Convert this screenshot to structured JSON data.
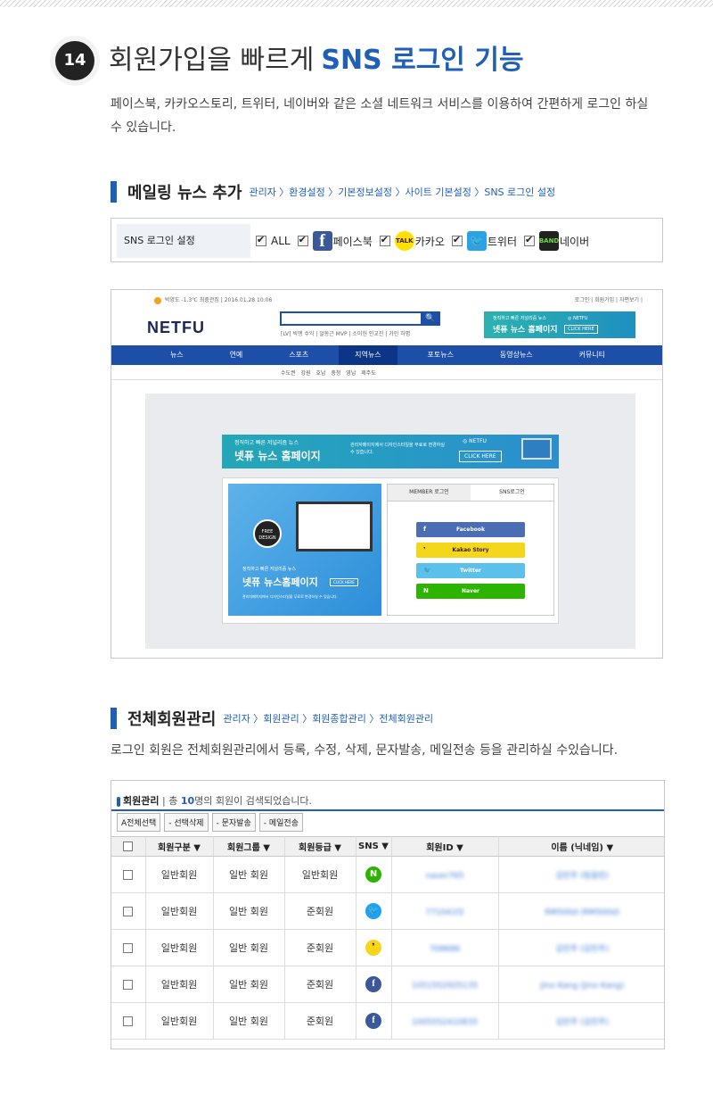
{
  "section": {
    "number": "14",
    "title_main": "회원가입을 빠르게",
    "title_highlight": "SNS 로그인 기능",
    "description": "페이스북, 카카오스토리, 트위터, 네이버와 같은 소셜 네트워크 서비스를 이용하여 간편하게 로그인 하실 수 있습니다."
  },
  "mailing": {
    "title": "메일링 뉴스 추가",
    "breadcrumb": "관리자 〉환경설정 〉기본정보설정 〉사이트 기본설정 〉SNS 로그인 설정",
    "settings_label": "SNS 로그인 설정",
    "options": [
      {
        "label": "ALL",
        "checked": true,
        "icon": ""
      },
      {
        "label": "페이스북",
        "checked": true,
        "icon": "facebook-icon"
      },
      {
        "label": "카카오",
        "checked": true,
        "icon": "kakaotalk-icon"
      },
      {
        "label": "트위터",
        "checked": true,
        "icon": "twitter-icon"
      },
      {
        "label": "네이버",
        "checked": true,
        "icon": "band-icon"
      }
    ]
  },
  "screenshot": {
    "weather": "박양도 -1.3℃ 최충관집 | 2016.01.28 10:06",
    "top_links": "로그인 | 회원가입 | 자편보기 |",
    "logo": "NETFU",
    "search_button": "🔍",
    "keywords": "[LV] 빅맹 수익 | 알동근 MVP | 소이헌 인교진 | 가인 하명",
    "banner": {
      "line1": "정직하고 빠른 저널리즘 뉴스",
      "line2": "넷퓨 뉴스 홈페이지",
      "brand": "◎ NETFU",
      "cta": "CLICK HERE"
    },
    "nav": [
      "뉴스",
      "연예",
      "스포츠",
      "지역뉴스",
      "포토뉴스",
      "동영상뉴스",
      "커뮤니티"
    ],
    "nav_active": 3,
    "subnav": "수도권 강원 호남 충청 영남 제주도",
    "inner_banner": {
      "line1": "정직하고 빠른 저널리즘 뉴스",
      "line2": "넷퓨 뉴스 홈페이지",
      "desc": "관리자페이지에서 디자인스타일을 무료로 변경하실 수 있습니다.",
      "brand": "◎ NETFU",
      "cta": "CLICK HERE"
    },
    "promo": {
      "badge": "FREE DESIGN",
      "line1": "정직하고 빠른 저널리즘 뉴스",
      "line2": "넷퓨 뉴스홈페이지",
      "cta": "CLICK HERE",
      "line3": "관리자페이지에서 디자인스타일을 무료로 변경하실 수 있습니다."
    },
    "tabs": [
      "MEMBER 로그인",
      "SNS로그인"
    ],
    "login_buttons": [
      {
        "label": "Facebook",
        "icon": "f",
        "color": "#4a6db4"
      },
      {
        "label": "Kakao Story",
        "icon": "❜",
        "color": "#f4d71a"
      },
      {
        "label": "Twitter",
        "icon": "🐦",
        "color": "#5bc0ea"
      },
      {
        "label": "Naver",
        "icon": "N",
        "color": "#2db400"
      }
    ]
  },
  "members": {
    "title": "전체회원관리",
    "breadcrumb": "관리자 〉회원관리 〉회원종합관리 〉전체회원관리",
    "description": "로그인 회원은 전체회원관리에서 등록, 수정, 삭제, 문자발송, 메일전송 등을 관리하실 수있습니다.",
    "panel_title": "회원관리",
    "count_prefix": "총",
    "count": "10",
    "count_suffix": "명의 회원이 검색되었습니다.",
    "actions": [
      "A전체선택",
      "- 선택삭제",
      "- 문자발송",
      "- 메일전송"
    ],
    "columns": [
      "회원구분 ▼",
      "회원그룹 ▼",
      "회원등급 ▼",
      "SNS ▼",
      "회원ID ▼",
      "이름 (닉네임) ▼"
    ],
    "rows": [
      {
        "type": "일반회원",
        "group": "일반 회원",
        "grade": "일반회원",
        "sns": "naver",
        "sns_glyph": "N",
        "id": "naver765",
        "name": "김민주 (링음린)"
      },
      {
        "type": "일반회원",
        "group": "일반 회원",
        "grade": "준회원",
        "sns": "twitter",
        "sns_glyph": "🐦",
        "id": "771041f2",
        "name": "RM500d (RM500d)"
      },
      {
        "type": "일반회원",
        "group": "일반 회원",
        "grade": "준회원",
        "sns": "kakao",
        "sns_glyph": "❜",
        "id": "708686",
        "name": "김민주 (김민주)"
      },
      {
        "type": "일반회원",
        "group": "일반 회원",
        "grade": "준회원",
        "sns": "facebook",
        "sns_glyph": "f",
        "id": "1051552925135",
        "name": "Jino Kang (Jino Kang)"
      },
      {
        "type": "일반회원",
        "group": "일반 회원",
        "grade": "준회원",
        "sns": "facebook",
        "sns_glyph": "f",
        "id": "1005552410835",
        "name": "김민주 (김민주)"
      }
    ]
  }
}
